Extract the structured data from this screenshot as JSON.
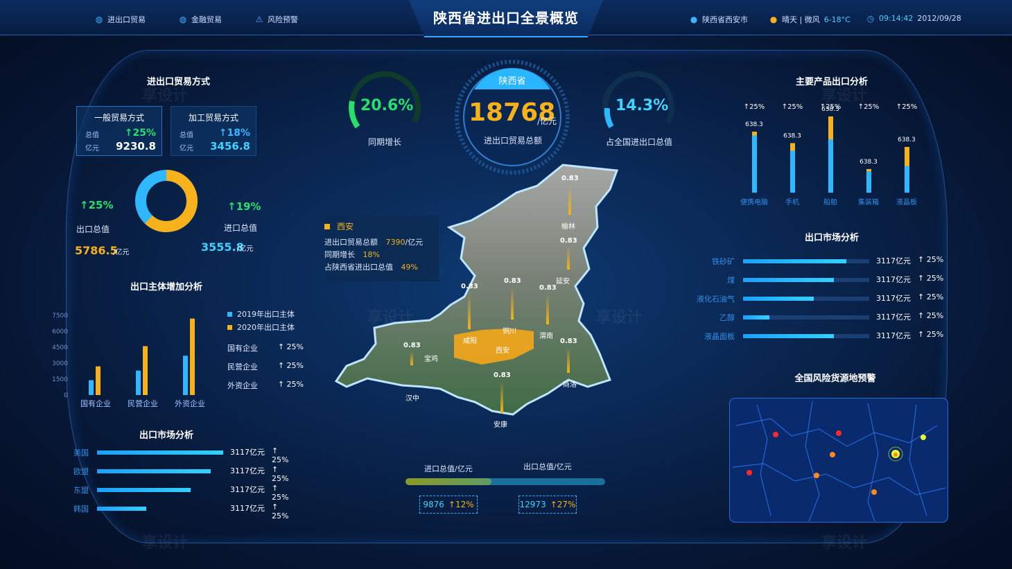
{
  "nav": {
    "items": [
      {
        "label": "进出口贸易",
        "icon": "globe-icon"
      },
      {
        "label": "金融贸易",
        "icon": "globe-icon"
      },
      {
        "label": "风险预警",
        "icon": "alert-icon"
      }
    ]
  },
  "header": {
    "title": "陕西省进出口全景概览"
  },
  "status": {
    "location": "陕西省西安市",
    "weather_label": "晴天 | 微风",
    "temp": "6-18°C",
    "time": "09:14:42",
    "date": "2012/09/28"
  },
  "left": {
    "trade_title": "进出口贸易方式",
    "cards": [
      {
        "title": "一般贸易方式",
        "k1": "总值",
        "k2": "亿元",
        "pct": "↑25%",
        "value": "9230.8"
      },
      {
        "title": "加工贸易方式",
        "k1": "总值",
        "k2": "亿元",
        "pct": "↑18%",
        "value": "3456.8"
      }
    ],
    "donut": {
      "export_pct": "↑25%",
      "export_label": "出口总值",
      "export_value": "5786.5",
      "unit": "/亿元",
      "import_pct": "↑19%",
      "import_label": "进口总值",
      "import_value": "3555.8",
      "export_share": 0.62
    },
    "entity_title": "出口主体增加分析",
    "entity_chart": {
      "yticks": [
        "7500",
        "6000",
        "4500",
        "3000",
        "1500",
        "0"
      ],
      "categories": [
        "国有企业",
        "民营企业",
        "外资企业"
      ],
      "series": [
        {
          "name": "2019年出口主体",
          "values": [
            1400,
            2300,
            3700
          ],
          "color": "#2fb8ff"
        },
        {
          "name": "2020年出口主体",
          "values": [
            2700,
            4600,
            7200
          ],
          "color": "#f7b21b"
        }
      ],
      "ymax": 7500
    },
    "entity_stats": [
      {
        "label": "国有企业",
        "pct": "↑ 25%"
      },
      {
        "label": "民营企业",
        "pct": "↑ 25%"
      },
      {
        "label": "外资企业",
        "pct": "↑ 25%"
      }
    ],
    "market_title": "出口市场分析",
    "market": [
      {
        "label": "美国",
        "value": "3117亿元",
        "pct": "↑ 25%",
        "frac": 1.0
      },
      {
        "label": "欧盟",
        "value": "3117亿元",
        "pct": "↑ 25%",
        "frac": 0.9
      },
      {
        "label": "东盟",
        "value": "3117亿元",
        "pct": "↑ 25%",
        "frac": 0.74
      },
      {
        "label": "韩国",
        "value": "3117亿元",
        "pct": "↑ 25%",
        "frac": 0.39
      }
    ]
  },
  "center": {
    "gauge_left": {
      "value": "20.6%",
      "label": "同期增长"
    },
    "gauge_main": {
      "province": "陕西省",
      "value": "18768",
      "unit": "/亿元",
      "label": "进出口贸易总额"
    },
    "gauge_right": {
      "value": "14.3%",
      "label": "占全国进出口总值"
    },
    "popup": {
      "city": "西安",
      "rows": [
        {
          "k": "进出口贸易总额",
          "v": "7390",
          "u": "/亿元"
        },
        {
          "k": "同期增长",
          "v": "18%",
          "u": ""
        },
        {
          "k": "占陕西省进出口总值",
          "v": "49%",
          "u": ""
        }
      ]
    },
    "cities": [
      {
        "name": "榆林",
        "val": "0.83"
      },
      {
        "name": "延安",
        "val": "0.83"
      },
      {
        "name": "铜川",
        "val": "0.83"
      },
      {
        "name": "渭南",
        "val": "0.83"
      },
      {
        "name": "咸阳",
        "val": "0.83"
      },
      {
        "name": "西安",
        "val": ""
      },
      {
        "name": "宝鸡",
        "val": "0.83"
      },
      {
        "name": "汉中",
        "val": ""
      },
      {
        "name": "商洛",
        "val": "0.83"
      },
      {
        "name": "安康",
        "val": "0.83"
      }
    ],
    "import_label": "进口总值/亿元",
    "export_label": "出口总值/亿元",
    "import_value": "9876",
    "import_pct": "↑12%",
    "export_value": "12973",
    "export_pct": "↑27%",
    "import_share": 0.43
  },
  "right": {
    "product_title": "主要产品出口分析",
    "products": [
      {
        "label": "便携电脑",
        "pct": "↑25%",
        "value": "638.3",
        "blue": 0.75,
        "orange": 0.05
      },
      {
        "label": "手机",
        "pct": "↑25%",
        "value": "638.3",
        "blue": 0.55,
        "orange": 0.1
      },
      {
        "label": "船舶",
        "pct": "↑25%",
        "value": "638.3",
        "blue": 0.7,
        "orange": 0.3
      },
      {
        "label": "集装箱",
        "pct": "↑25%",
        "value": "638.3",
        "blue": 0.28,
        "orange": 0.03
      },
      {
        "label": "液晶板",
        "pct": "↑25%",
        "value": "638.3",
        "blue": 0.35,
        "orange": 0.25
      }
    ],
    "market_title": "出口市场分析",
    "market": [
      {
        "label": "铁砂矿",
        "value": "3117亿元",
        "pct": "↑ 25%",
        "frac": 0.82
      },
      {
        "label": "煤",
        "value": "3117亿元",
        "pct": "↑ 25%",
        "frac": 0.72
      },
      {
        "label": "液化石油气",
        "value": "3117亿元",
        "pct": "↑ 25%",
        "frac": 0.56
      },
      {
        "label": "乙醇",
        "value": "3117亿元",
        "pct": "↑ 25%",
        "frac": 0.21
      },
      {
        "label": "液晶面板",
        "value": "3117亿元",
        "pct": "↑ 25%",
        "frac": 0.72
      }
    ],
    "risk_title": "全国风险货源地预警"
  }
}
